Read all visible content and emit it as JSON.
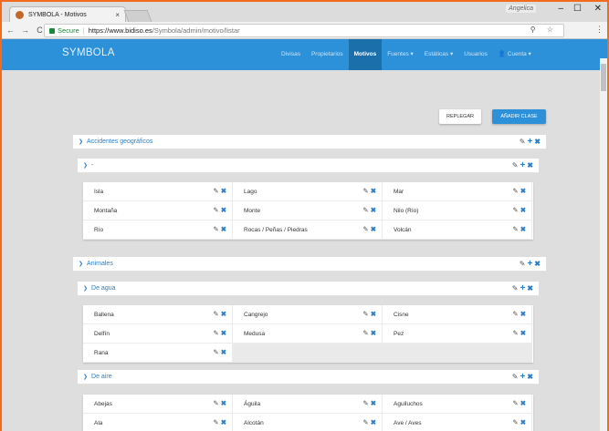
{
  "browser": {
    "tab_title": "SYMBOLA - Motivos",
    "tab_close": "×",
    "window_logo": "Angelica",
    "ctl_minimize": "–",
    "ctl_maximize": "☐",
    "ctl_close": "✕",
    "nav_back": "←",
    "nav_forward": "→",
    "nav_reload": "C",
    "secure_label": "Secure",
    "url_scheme_host": "https://www.bidiso.es",
    "url_path": "/Symbola/admin/motivo/listar",
    "omni_icons": "⚲ ☆",
    "menu": "⋮"
  },
  "app": {
    "brand": "SYMBOLA",
    "nav": [
      {
        "label": "Divisas",
        "active": false
      },
      {
        "label": "Propietarios",
        "active": false
      },
      {
        "label": "Motivos",
        "active": true
      },
      {
        "label": "Fuentes ▾",
        "active": false
      },
      {
        "label": "Estáticas ▾",
        "active": false
      },
      {
        "label": "Usuarios",
        "active": false
      },
      {
        "label": "👤 Cuenta ▾",
        "active": false
      }
    ]
  },
  "actions": {
    "replegar": "REPLEGAR",
    "add_class": "AÑADIR CLASE"
  },
  "icons": {
    "chevron": "❯",
    "edit": "✎",
    "add": "+",
    "delete": "✖",
    "colors": {
      "accent": "#2c7fc7",
      "nav": "#2c91d8",
      "nav_active": "#1b6fab"
    }
  },
  "groups": [
    {
      "title": "Accidentes geográficos",
      "subgroups": [
        {
          "title": "-",
          "items": [
            "Isla",
            "Lago",
            "Mar",
            "Montaña",
            "Monte",
            "Nilo (Río)",
            "Río",
            "Rocas / Peñas / Piedras",
            "Volcán"
          ]
        }
      ]
    },
    {
      "title": "Animales",
      "subgroups": [
        {
          "title": "De agua",
          "items": [
            "Ballena",
            "Cangrejo",
            "Cisne",
            "Delfín",
            "Medusa",
            "Pez",
            "Rana"
          ]
        },
        {
          "title": "De aire",
          "items": [
            "Abejas",
            "Águila",
            "Aguiluchos",
            "Ala",
            "Alcotán",
            "Ave / Aves"
          ]
        }
      ]
    }
  ]
}
